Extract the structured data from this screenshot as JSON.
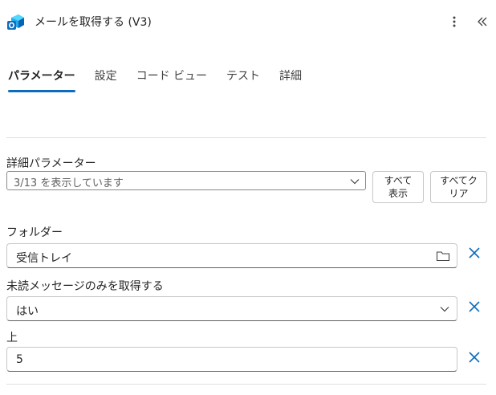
{
  "header": {
    "title": "メールを取得する (V3)",
    "app_icon": "outlook-icon",
    "more_icon": "more-vertical-icon",
    "collapse_icon": "double-chevron-left-icon"
  },
  "tabs": [
    {
      "label": "パラメーター",
      "active": true
    },
    {
      "label": "設定",
      "active": false
    },
    {
      "label": "コード ビュー",
      "active": false
    },
    {
      "label": "テスト",
      "active": false
    },
    {
      "label": "詳細",
      "active": false
    }
  ],
  "advanced": {
    "label": "詳細パラメーター",
    "select_value": "3/13 を表示しています",
    "show_all_line1": "すべて",
    "show_all_line2": "表示",
    "clear_all_line1": "すべてク",
    "clear_all_line2": "リア"
  },
  "fields": {
    "folder": {
      "label": "フォルダー",
      "value": "受信トレイ",
      "icon": "folder-icon"
    },
    "unread": {
      "label": "未読メッセージのみを取得する",
      "value": "はい",
      "icon": "chevron-down-icon"
    },
    "top": {
      "label": "上",
      "value": "5"
    }
  },
  "colors": {
    "accent": "#0f6cbd",
    "text": "#242424",
    "border": "#c7c7c7"
  }
}
